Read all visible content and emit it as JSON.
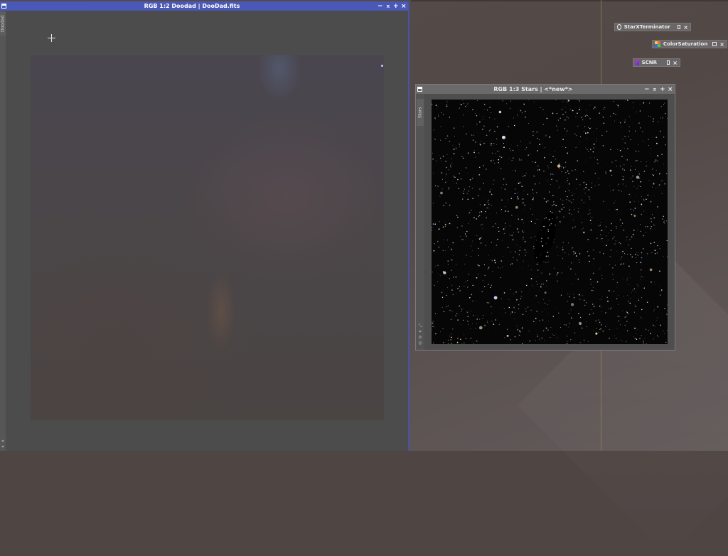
{
  "workspace": {
    "background": "#524846"
  },
  "window_main": {
    "title": "RGB 1:2 Doodad | DooDad.fits",
    "side_tab": "Doodad",
    "accent": "#4a58b8",
    "controls": [
      "−",
      "⌅",
      "+",
      "×"
    ]
  },
  "window_stars": {
    "title": "RGB 1:3 Stars | <*new*>",
    "side_tab": "Stars",
    "controls": [
      "−",
      "⌅",
      "+",
      "×"
    ]
  },
  "tools": [
    {
      "label": "StarXTerminator",
      "icon": "starxterminator-icon"
    },
    {
      "label": "ColorSaturation",
      "icon": "colorsaturation-icon"
    },
    {
      "label": "SCNR",
      "icon": "scnr-icon"
    }
  ]
}
